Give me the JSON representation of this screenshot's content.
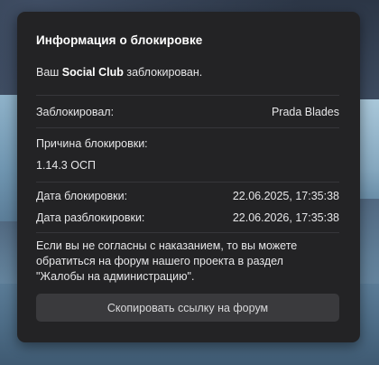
{
  "modal": {
    "title": "Информация о блокировке",
    "account_prefix": "Ваш ",
    "account_name": "Social Club",
    "account_suffix": " заблокирован.",
    "blocked_by_label": "Заблокировал:",
    "blocked_by_value": "Prada Blades",
    "reason_label": "Причина блокировки:",
    "reason_value": "1.14.3 ОСП",
    "block_date_label": "Дата блокировки:",
    "block_date_value": "22.06.2025, 17:35:38",
    "unblock_date_label": "Дата разблокировки:",
    "unblock_date_value": "22.06.2026, 17:35:38",
    "notice": "Если вы не согласны с наказанием, то вы можете обратиться на форум нашего проекта в раздел \"Жалобы на администрацию\".",
    "copy_button_label": "Скопировать ссылку на форум"
  },
  "colors": {
    "modal_background": "#232325",
    "button_background": "#3a3a3d",
    "divider": "#36363a"
  }
}
